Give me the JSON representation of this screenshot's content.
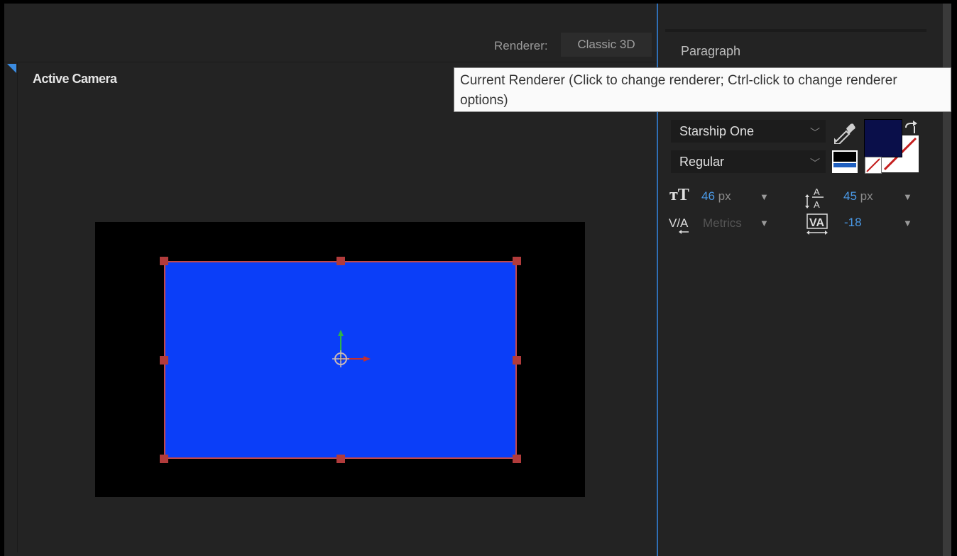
{
  "composition": {
    "renderer_label": "Renderer:",
    "renderer_value": "Classic 3D",
    "view_label": "Active Camera"
  },
  "tooltip": {
    "text": "Current Renderer (Click to change renderer; Ctrl-click to change renderer options)"
  },
  "right_panel": {
    "title": "Paragraph",
    "font_family": "Starship One",
    "font_style": "Regular",
    "font_size": "46",
    "font_size_unit": "px",
    "leading": "45",
    "leading_unit": "px",
    "kerning": "Metrics",
    "tracking": "-18"
  },
  "colors": {
    "accent": "#3b8be0",
    "layer_fill": "#0b3ef8",
    "layer_outline": "#c44848",
    "fill_swatch": "#0a0f4a",
    "value_blue": "#4a9ae8"
  },
  "icons": {
    "eyedropper": "eyedropper-icon",
    "swap": "swap-colors-icon",
    "font_size": "font-size-icon",
    "leading": "leading-icon",
    "kerning": "kerning-icon",
    "tracking": "tracking-icon"
  }
}
